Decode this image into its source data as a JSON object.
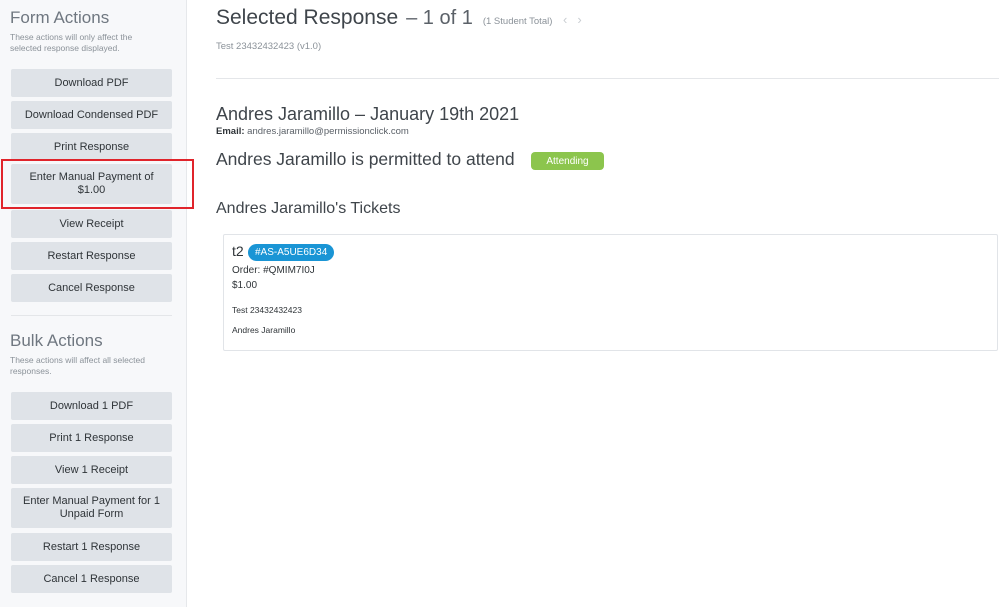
{
  "sidebar": {
    "form_actions": {
      "title": "Form Actions",
      "description": "These actions will only affect the selected response displayed.",
      "buttons": [
        "Download PDF",
        "Download Condensed PDF",
        "Print Response",
        "Enter Manual Payment of $1.00",
        "View Receipt",
        "Restart Response",
        "Cancel Response"
      ]
    },
    "bulk_actions": {
      "title": "Bulk Actions",
      "description": "These actions will affect all selected responses.",
      "buttons": [
        "Download 1 PDF",
        "Print 1 Response",
        "View 1 Receipt",
        "Enter Manual Payment for 1 Unpaid Form",
        "Restart 1 Response",
        "Cancel 1 Response"
      ]
    }
  },
  "header": {
    "title": "Selected Response",
    "count": "– 1 of 1",
    "total": "(1 Student Total)",
    "prev_arrow": "‹",
    "next_arrow": "›",
    "subtitle": "Test 23432432423 (v1.0)"
  },
  "response": {
    "name_date": "Andres Jaramillo – January 19th 2021",
    "email_label": "Email:",
    "email": "andres.jaramillo@permissionclick.com",
    "permission_text": "Andres Jaramillo is permitted to attend",
    "status_badge": "Attending",
    "status_color": "#8cc54d"
  },
  "tickets": {
    "title": "Andres Jaramillo's Tickets",
    "items": [
      {
        "name": "t2",
        "code": "#AS-A5UE6D34",
        "order": "Order: #QMIM7I0J",
        "price": "$1.00",
        "form": "Test 23432432423",
        "student": "Andres Jaramillo"
      }
    ]
  },
  "colors": {
    "highlight": "#e0242b",
    "ticket_code_bg": "#1a95d5",
    "button_bg": "#dfe3e8"
  }
}
